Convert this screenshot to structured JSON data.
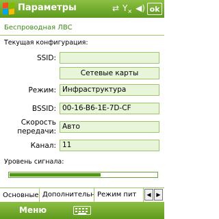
{
  "window": {
    "title": "Параметры",
    "ok_label": "ok",
    "status_icons": [
      "sync-icon",
      "signal-off-icon",
      "speaker-icon"
    ],
    "accent_color": "#5d9a1d"
  },
  "subheader": {
    "title": "Беспроводная ЛВС"
  },
  "config": {
    "section_label": "Текущая конфигурация:",
    "ssid_label": "SSID:",
    "ssid_value": "",
    "network_cards_button": "Сетевые карты",
    "mode_label": "Режим:",
    "mode_value": "Инфраструктура",
    "bssid_label": "BSSID:",
    "bssid_value": "00-16-B6-1E-7D-CF",
    "speed_label_line1": "Скорость",
    "speed_label_line2": "передачи:",
    "speed_value": "Авто",
    "channel_label": "Канал:",
    "channel_value": "11"
  },
  "signal": {
    "label": "Уровень сигнала:",
    "level_fraction": 0.62
  },
  "tabs": [
    {
      "label": "Основные",
      "active": true
    },
    {
      "label": "Дополнительно",
      "active": false
    },
    {
      "label": "Режим пит",
      "active": false
    }
  ],
  "bottombar": {
    "menu_label": "Меню"
  }
}
